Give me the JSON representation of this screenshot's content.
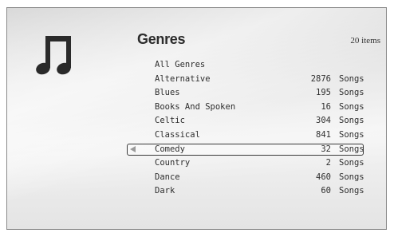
{
  "header": {
    "title": "Genres",
    "item_count": "20 items",
    "icon": "music-note-icon"
  },
  "colors": {
    "text": "#2e2e2e",
    "selection_border": "#3a3a3a",
    "arrow": "#9a9a9a"
  },
  "genres": [
    {
      "name": "All Genres",
      "count": "",
      "unit": ""
    },
    {
      "name": "Alternative",
      "count": "2876",
      "unit": "Songs"
    },
    {
      "name": "Blues",
      "count": "195",
      "unit": "Songs"
    },
    {
      "name": "Books And Spoken",
      "count": "16",
      "unit": "Songs"
    },
    {
      "name": "Celtic",
      "count": "304",
      "unit": "Songs"
    },
    {
      "name": "Classical",
      "count": "841",
      "unit": "Songs"
    },
    {
      "name": "Comedy",
      "count": "32",
      "unit": "Songs",
      "selected": true
    },
    {
      "name": "Country",
      "count": "2",
      "unit": "Songs"
    },
    {
      "name": "Dance",
      "count": "460",
      "unit": "Songs"
    },
    {
      "name": "Dark",
      "count": "60",
      "unit": "Songs"
    }
  ]
}
